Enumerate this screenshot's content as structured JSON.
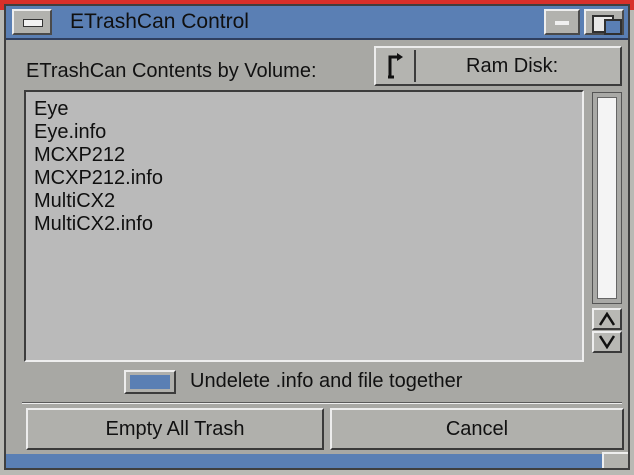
{
  "window": {
    "title": "ETrashCan Control"
  },
  "volume": {
    "label": "ETrashCan Contents by Volume:",
    "selected": "Ram Disk:"
  },
  "files": [
    "Eye",
    "Eye.info",
    "MCXP212",
    "MCXP212.info",
    "MultiCX2",
    "MultiCX2.info"
  ],
  "options": {
    "undelete_together_label": "Undelete .info and file together",
    "undelete_together_checked": true
  },
  "buttons": {
    "empty_all": "Empty All Trash",
    "cancel": "Cancel"
  },
  "colors": {
    "title_bar": "#5a7fb4",
    "window_bg": "#a8a8a4",
    "list_bg": "#bababa"
  }
}
